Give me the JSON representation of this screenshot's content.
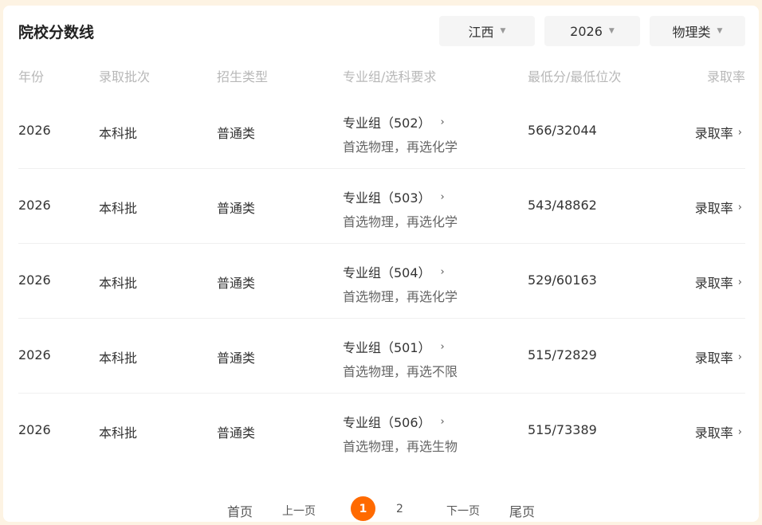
{
  "header": {
    "title": "院校分数线"
  },
  "filters": [
    {
      "value": "江西"
    },
    {
      "value": "2026"
    },
    {
      "value": "物理类"
    }
  ],
  "columns": [
    "年份",
    "录取批次",
    "招生类型",
    "专业组/选科要求",
    "最低分/最低位次",
    "录取率"
  ],
  "rows": [
    {
      "year": "2026",
      "batch": "本科批",
      "type": "普通类",
      "group": "专业组（502）",
      "subjects": "首选物理，再选化学",
      "score": "566/32044",
      "rate": "录取率"
    },
    {
      "year": "2026",
      "batch": "本科批",
      "type": "普通类",
      "group": "专业组（503）",
      "subjects": "首选物理，再选化学",
      "score": "543/48862",
      "rate": "录取率"
    },
    {
      "year": "2026",
      "batch": "本科批",
      "type": "普通类",
      "group": "专业组（504）",
      "subjects": "首选物理，再选化学",
      "score": "529/60163",
      "rate": "录取率"
    },
    {
      "year": "2026",
      "batch": "本科批",
      "type": "普通类",
      "group": "专业组（501）",
      "subjects": "首选物理，再选不限",
      "score": "515/72829",
      "rate": "录取率"
    },
    {
      "year": "2026",
      "batch": "本科批",
      "type": "普通类",
      "group": "专业组（506）",
      "subjects": "首选物理，再选生物",
      "score": "515/73389",
      "rate": "录取率"
    }
  ],
  "pagination": {
    "first": "首页",
    "prev": "上一页",
    "pages": [
      "1",
      "2"
    ],
    "current": "1",
    "next": "下一页",
    "last": "尾页"
  },
  "colors": {
    "accent": "#ff6a00",
    "background": "#fdf3e3"
  }
}
